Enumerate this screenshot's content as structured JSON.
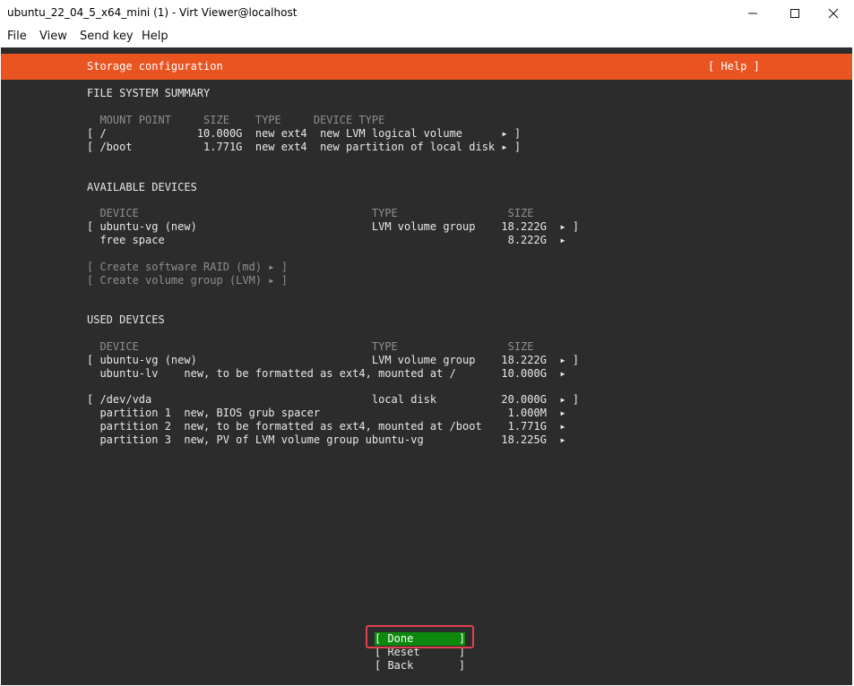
{
  "window": {
    "title": "ubuntu_22_04_5_x64_mini (1) - Virt Viewer@localhost",
    "minimize_icon": "minimize-icon",
    "maximize_icon": "maximize-icon",
    "close_icon": "close-icon"
  },
  "menu": [
    "File",
    "View",
    "Send key",
    "Help"
  ],
  "header": {
    "title": "Storage configuration",
    "help": "[ Help ]"
  },
  "fs_summary": {
    "heading": "FILE SYSTEM SUMMARY",
    "columns": "  MOUNT POINT     SIZE    TYPE     DEVICE TYPE",
    "rows": [
      "[ /              10.000G  new ext4  new LVM logical volume      ▸ ]",
      "[ /boot           1.771G  new ext4  new partition of local disk ▸ ]"
    ]
  },
  "available": {
    "heading": "AVAILABLE DEVICES",
    "columns": "  DEVICE                                    TYPE                 SIZE",
    "rows": [
      "[ ubuntu-vg (new)                           LVM volume group    18.222G  ▸ ]",
      "  free space                                                     8.222G  ▸"
    ],
    "actions": [
      "[ Create software RAID (md) ▸ ]",
      "[ Create volume group (LVM) ▸ ]"
    ]
  },
  "used": {
    "heading": "USED DEVICES",
    "columns": "  DEVICE                                    TYPE                 SIZE",
    "group1": [
      "[ ubuntu-vg (new)                           LVM volume group    18.222G  ▸ ]",
      "  ubuntu-lv    new, to be formatted as ext4, mounted at /       10.000G  ▸"
    ],
    "group2": [
      "[ /dev/vda                                  local disk          20.000G  ▸ ]",
      "  partition 1  new, BIOS grub spacer                             1.000M  ▸",
      "  partition 2  new, to be formatted as ext4, mounted at /boot    1.771G  ▸",
      "  partition 3  new, PV of LVM volume group ubuntu-vg            18.225G  ▸"
    ]
  },
  "buttons": {
    "done": "[ Done       ]",
    "reset": "[ Reset      ]",
    "back": "[ Back       ]"
  }
}
